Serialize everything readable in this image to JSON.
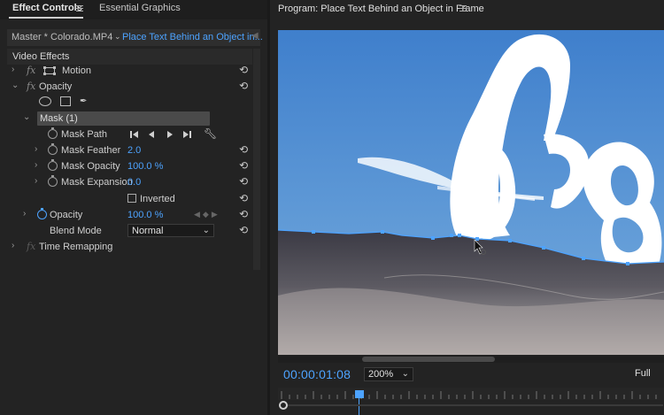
{
  "effect_controls": {
    "tab_effect_controls": "Effect Controls",
    "tab_essential_graphics": "Essential Graphics",
    "source_clip": "Master * Colorado.MP4",
    "sequence_clip": "Place Text Behind an Object in...",
    "video_effects_label": "Video Effects",
    "motion_label": "Motion",
    "opacity_label": "Opacity",
    "mask_name": "Mask (1)",
    "mask_path_label": "Mask Path",
    "mask_feather_label": "Mask Feather",
    "mask_feather_value": "2.0",
    "mask_opacity_label": "Mask Opacity",
    "mask_opacity_value": "100.0 %",
    "mask_expansion_label": "Mask Expansion",
    "mask_expansion_value": "0.0",
    "inverted_label": "Inverted",
    "opacity_param_label": "Opacity",
    "opacity_value": "100.0 %",
    "blend_mode_label": "Blend Mode",
    "blend_mode_value": "Normal",
    "time_remapping_label": "Time Remapping"
  },
  "program": {
    "title": "Program: Place Text Behind an Object in Frame",
    "timecode": "00:00:01:08",
    "zoom": "200%",
    "resolution": "Full"
  },
  "colors": {
    "accent_blue": "#4da3ff",
    "panel_bg": "#232323"
  }
}
